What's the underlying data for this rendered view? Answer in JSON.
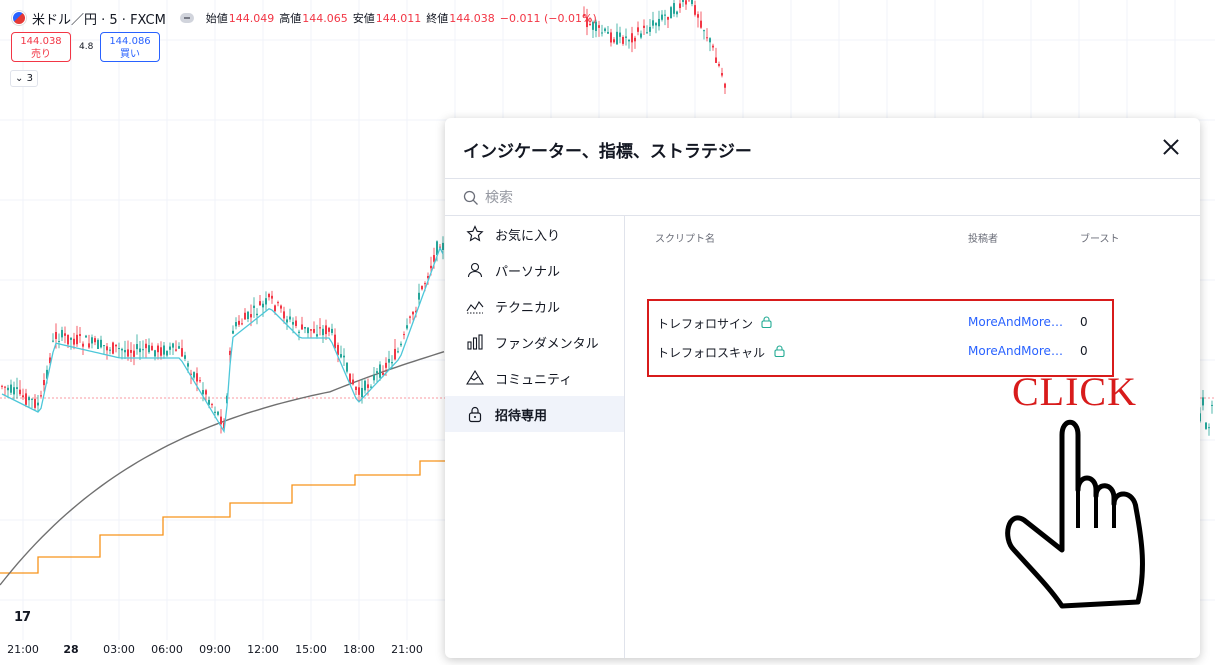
{
  "chart_header": {
    "symbol": "米ドル／円 · 5 · FXCM",
    "ohlc": [
      {
        "label": "始値",
        "value": "144.049"
      },
      {
        "label": "高値",
        "value": "144.065"
      },
      {
        "label": "安値",
        "value": "144.011"
      },
      {
        "label": "終値",
        "value": "144.038"
      }
    ],
    "change": "−0.011 (−0.01%)",
    "sell_price": "144.038",
    "sell_label": "売り",
    "spread": "4.8",
    "buy_price": "144.086",
    "buy_label": "買い",
    "indicator_count": "3",
    "logo": "17"
  },
  "time_axis": [
    "21:00",
    "28",
    "03:00",
    "06:00",
    "09:00",
    "12:00",
    "15:00",
    "18:00",
    "21:00"
  ],
  "dialog": {
    "title": "インジケーター、指標、ストラテジー",
    "search_placeholder": "検索",
    "sidebar": [
      {
        "label": "お気に入り",
        "icon": "star-icon",
        "active": false
      },
      {
        "label": "パーソナル",
        "icon": "person-icon",
        "active": false
      },
      {
        "label": "テクニカル",
        "icon": "technical-chart-icon",
        "active": false
      },
      {
        "label": "ファンダメンタル",
        "icon": "bar-chart-icon",
        "active": false
      },
      {
        "label": "コミュニティ",
        "icon": "community-mountain-icon",
        "active": false
      },
      {
        "label": "招待専用",
        "icon": "lock-icon",
        "active": true
      }
    ],
    "columns": {
      "script": "スクリプト名",
      "author": "投稿者",
      "boost": "ブースト"
    },
    "scripts": [
      {
        "name": "トレフォロサイン",
        "author": "MoreAndMoreI...",
        "boost": "0"
      },
      {
        "name": "トレフォロスキャル",
        "author": "MoreAndMoreI...",
        "boost": "0"
      }
    ]
  },
  "annotation": {
    "click_text": "CLICK",
    "color": "#d81b1b"
  },
  "colors": {
    "up": "#26a69a",
    "down": "#f23645",
    "ma_fast": "#4dc7d9",
    "ma_slow": "#707070",
    "step": "#f7931a"
  }
}
